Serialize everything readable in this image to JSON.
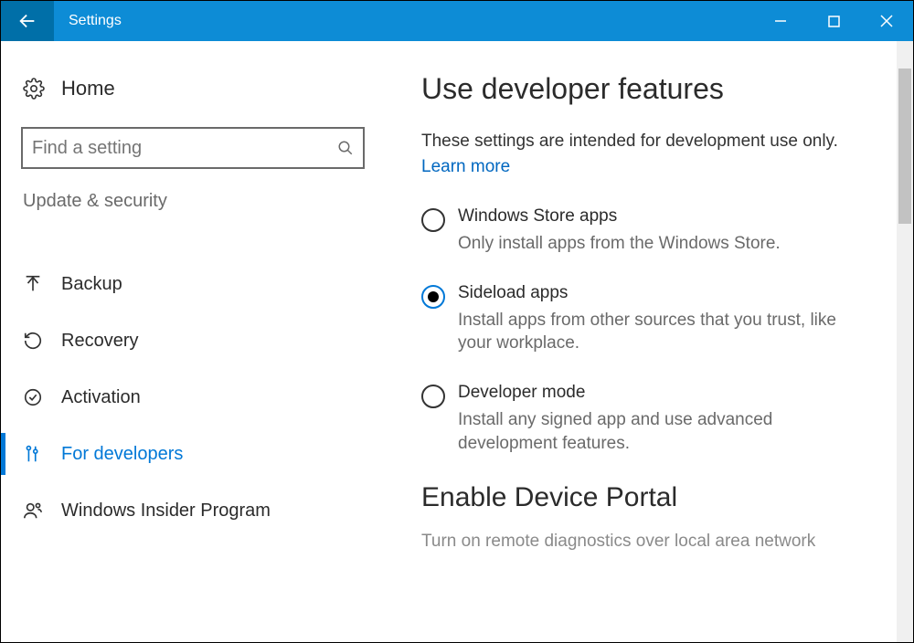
{
  "window": {
    "title": "Settings"
  },
  "sidebar": {
    "home_label": "Home",
    "search_placeholder": "Find a setting",
    "section_label": "Update & security",
    "items": [
      {
        "label": "Backup",
        "selected": false
      },
      {
        "label": "Recovery",
        "selected": false
      },
      {
        "label": "Activation",
        "selected": false
      },
      {
        "label": "For developers",
        "selected": true
      },
      {
        "label": "Windows Insider Program",
        "selected": false
      }
    ]
  },
  "main": {
    "heading": "Use developer features",
    "subtitle": "These settings are intended for development use only.",
    "learn_more": "Learn more",
    "options": [
      {
        "title": "Windows Store apps",
        "description": "Only install apps from the Windows Store.",
        "selected": false
      },
      {
        "title": "Sideload apps",
        "description": "Install apps from other sources that you trust, like your workplace.",
        "selected": true
      },
      {
        "title": "Developer mode",
        "description": "Install any signed app and use advanced development features.",
        "selected": false
      }
    ],
    "portal_heading": "Enable Device Portal",
    "portal_desc": "Turn on remote diagnostics over local area network"
  }
}
